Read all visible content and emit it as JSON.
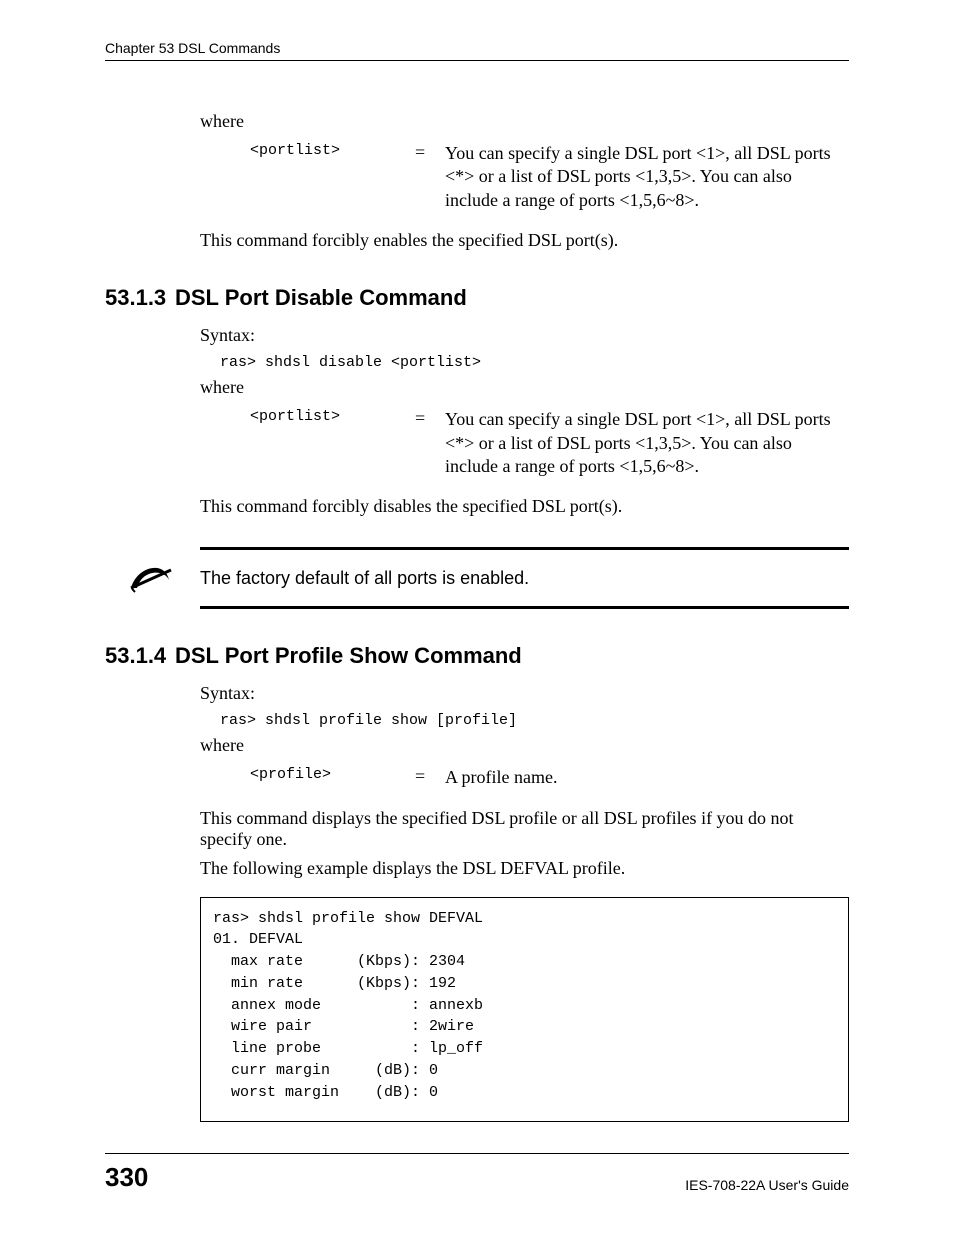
{
  "header": {
    "chapter": "Chapter 53 DSL Commands"
  },
  "sec_enable": {
    "where": "where",
    "param_name": "<portlist>",
    "eq": "=",
    "param_desc": "You can specify a single DSL port <1>, all DSL ports <*> or a list of DSL ports <1,3,5>. You can also include a range of ports <1,5,6~8>.",
    "concl": "This command forcibly enables the specified DSL port(s)."
  },
  "sec_disable": {
    "num": "53.1.3",
    "title": "DSL Port Disable Command",
    "syntax_label": "Syntax:",
    "syntax_cmd": "ras> shdsl disable <portlist>",
    "where": "where",
    "param_name": "<portlist>",
    "eq": "=",
    "param_desc": "You can specify a single DSL port <1>, all DSL ports <*> or a list of DSL ports <1,3,5>. You can also include a range of ports <1,5,6~8>.",
    "concl": "This command forcibly disables the specified DSL port(s).",
    "note": "The factory default of all ports is enabled."
  },
  "sec_profile": {
    "num": "53.1.4",
    "title": "DSL Port Profile Show Command",
    "syntax_label": "Syntax:",
    "syntax_cmd": "ras> shdsl profile show [profile]",
    "where": "where",
    "param_name": "<profile>",
    "eq": "=",
    "param_desc": "A profile name.",
    "concl1": "This command displays the specified DSL profile or all DSL profiles if you do not specify one.",
    "concl2": "The following example displays the DSL DEFVAL profile.",
    "terminal": "ras> shdsl profile show DEFVAL\n01. DEFVAL\n  max rate      (Kbps): 2304\n  min rate      (Kbps): 192\n  annex mode          : annexb\n  wire pair           : 2wire\n  line probe          : lp_off\n  curr margin     (dB): 0\n  worst margin    (dB): 0"
  },
  "footer": {
    "page": "330",
    "guide": "IES-708-22A User's Guide"
  }
}
